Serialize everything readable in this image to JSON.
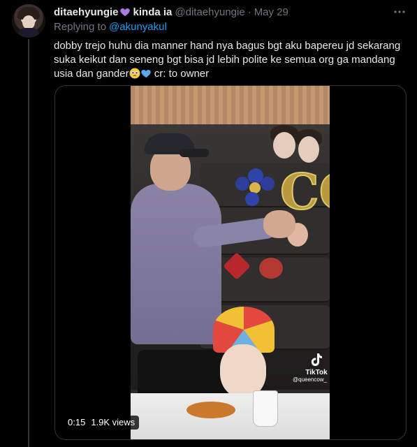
{
  "tweet": {
    "display_name": "ditaehyungie",
    "display_name_tail": "kinda ia",
    "handle": "@ditaehyungie",
    "dot": "·",
    "date": "May 29",
    "replying_prefix": "Replying to",
    "replying_to": "@akunyakul",
    "text_main": "dobby trejo huhu dia manner hand nya bagus bgt aku bapereu jd sekarang suka keikut dan seneng bgt bisa jd lebih polite ke semua org ga mandang usia dan gander",
    "text_tail": " cr: to owner"
  },
  "media": {
    "duration": "0:15",
    "views": "1.9K views",
    "tiktok_label": "TikTok",
    "tiktok_user": "@queencow_"
  },
  "colors": {
    "background": "#000000",
    "text": "#e7e9ea",
    "muted": "#71767b",
    "link": "#1d9bf0",
    "heart_purple": "#a97ae8",
    "heart_blue": "#5aa9e8"
  },
  "icons": {
    "name_emoji": "purple-heart-icon",
    "text_emoji_1": "pleading-face-icon",
    "text_emoji_2": "blue-heart-icon",
    "more": "more-horizontal-icon",
    "watermark": "tiktok-icon"
  }
}
